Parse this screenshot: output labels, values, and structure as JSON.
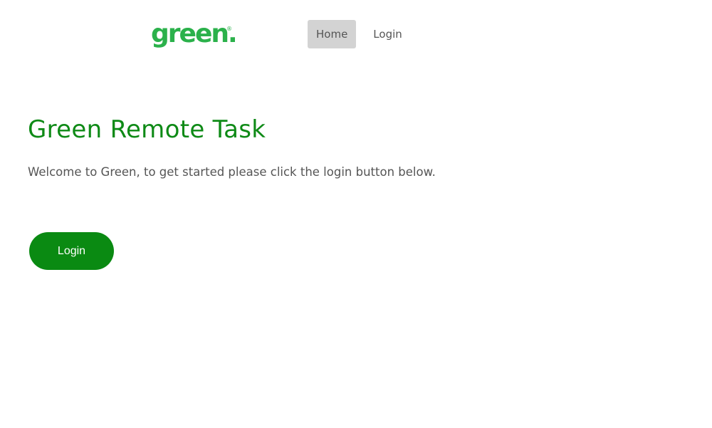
{
  "header": {
    "logo_text": "green.",
    "logo_mark": "®",
    "nav": {
      "items": [
        {
          "label": "Home",
          "active": true
        },
        {
          "label": "Login",
          "active": false
        }
      ]
    }
  },
  "main": {
    "title": "Green Remote Task",
    "welcome_text": "Welcome to Green, to get started please click the login button below.",
    "login_button_label": "Login"
  },
  "colors": {
    "brand_green": "#2bb14b",
    "title_green": "#0e8a16",
    "button_green": "#0a8a12",
    "nav_active_bg": "#d3d3d3",
    "body_text": "#555555"
  }
}
